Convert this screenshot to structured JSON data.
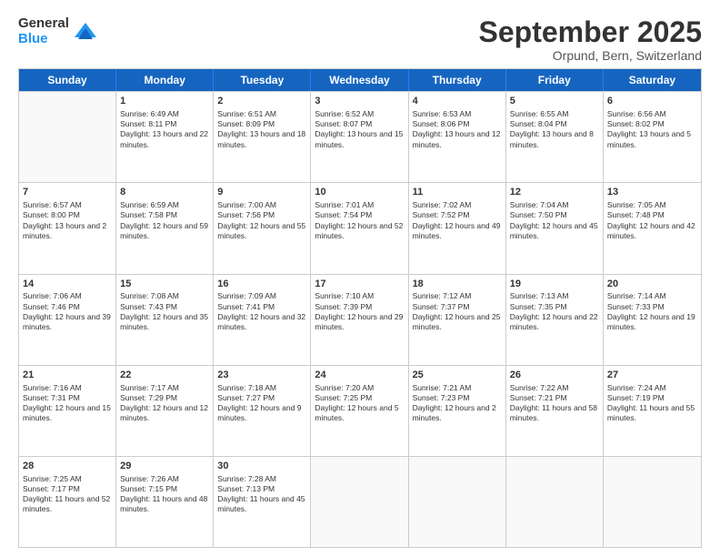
{
  "logo": {
    "general": "General",
    "blue": "Blue"
  },
  "title": {
    "month": "September 2025",
    "location": "Orpund, Bern, Switzerland"
  },
  "header_days": [
    "Sunday",
    "Monday",
    "Tuesday",
    "Wednesday",
    "Thursday",
    "Friday",
    "Saturday"
  ],
  "weeks": [
    [
      {
        "day": "",
        "empty": true
      },
      {
        "day": "1",
        "sunrise": "Sunrise: 6:49 AM",
        "sunset": "Sunset: 8:11 PM",
        "daylight": "Daylight: 13 hours and 22 minutes."
      },
      {
        "day": "2",
        "sunrise": "Sunrise: 6:51 AM",
        "sunset": "Sunset: 8:09 PM",
        "daylight": "Daylight: 13 hours and 18 minutes."
      },
      {
        "day": "3",
        "sunrise": "Sunrise: 6:52 AM",
        "sunset": "Sunset: 8:07 PM",
        "daylight": "Daylight: 13 hours and 15 minutes."
      },
      {
        "day": "4",
        "sunrise": "Sunrise: 6:53 AM",
        "sunset": "Sunset: 8:06 PM",
        "daylight": "Daylight: 13 hours and 12 minutes."
      },
      {
        "day": "5",
        "sunrise": "Sunrise: 6:55 AM",
        "sunset": "Sunset: 8:04 PM",
        "daylight": "Daylight: 13 hours and 8 minutes."
      },
      {
        "day": "6",
        "sunrise": "Sunrise: 6:56 AM",
        "sunset": "Sunset: 8:02 PM",
        "daylight": "Daylight: 13 hours and 5 minutes."
      }
    ],
    [
      {
        "day": "7",
        "sunrise": "Sunrise: 6:57 AM",
        "sunset": "Sunset: 8:00 PM",
        "daylight": "Daylight: 13 hours and 2 minutes."
      },
      {
        "day": "8",
        "sunrise": "Sunrise: 6:59 AM",
        "sunset": "Sunset: 7:58 PM",
        "daylight": "Daylight: 12 hours and 59 minutes."
      },
      {
        "day": "9",
        "sunrise": "Sunrise: 7:00 AM",
        "sunset": "Sunset: 7:56 PM",
        "daylight": "Daylight: 12 hours and 55 minutes."
      },
      {
        "day": "10",
        "sunrise": "Sunrise: 7:01 AM",
        "sunset": "Sunset: 7:54 PM",
        "daylight": "Daylight: 12 hours and 52 minutes."
      },
      {
        "day": "11",
        "sunrise": "Sunrise: 7:02 AM",
        "sunset": "Sunset: 7:52 PM",
        "daylight": "Daylight: 12 hours and 49 minutes."
      },
      {
        "day": "12",
        "sunrise": "Sunrise: 7:04 AM",
        "sunset": "Sunset: 7:50 PM",
        "daylight": "Daylight: 12 hours and 45 minutes."
      },
      {
        "day": "13",
        "sunrise": "Sunrise: 7:05 AM",
        "sunset": "Sunset: 7:48 PM",
        "daylight": "Daylight: 12 hours and 42 minutes."
      }
    ],
    [
      {
        "day": "14",
        "sunrise": "Sunrise: 7:06 AM",
        "sunset": "Sunset: 7:46 PM",
        "daylight": "Daylight: 12 hours and 39 minutes."
      },
      {
        "day": "15",
        "sunrise": "Sunrise: 7:08 AM",
        "sunset": "Sunset: 7:43 PM",
        "daylight": "Daylight: 12 hours and 35 minutes."
      },
      {
        "day": "16",
        "sunrise": "Sunrise: 7:09 AM",
        "sunset": "Sunset: 7:41 PM",
        "daylight": "Daylight: 12 hours and 32 minutes."
      },
      {
        "day": "17",
        "sunrise": "Sunrise: 7:10 AM",
        "sunset": "Sunset: 7:39 PM",
        "daylight": "Daylight: 12 hours and 29 minutes."
      },
      {
        "day": "18",
        "sunrise": "Sunrise: 7:12 AM",
        "sunset": "Sunset: 7:37 PM",
        "daylight": "Daylight: 12 hours and 25 minutes."
      },
      {
        "day": "19",
        "sunrise": "Sunrise: 7:13 AM",
        "sunset": "Sunset: 7:35 PM",
        "daylight": "Daylight: 12 hours and 22 minutes."
      },
      {
        "day": "20",
        "sunrise": "Sunrise: 7:14 AM",
        "sunset": "Sunset: 7:33 PM",
        "daylight": "Daylight: 12 hours and 19 minutes."
      }
    ],
    [
      {
        "day": "21",
        "sunrise": "Sunrise: 7:16 AM",
        "sunset": "Sunset: 7:31 PM",
        "daylight": "Daylight: 12 hours and 15 minutes."
      },
      {
        "day": "22",
        "sunrise": "Sunrise: 7:17 AM",
        "sunset": "Sunset: 7:29 PM",
        "daylight": "Daylight: 12 hours and 12 minutes."
      },
      {
        "day": "23",
        "sunrise": "Sunrise: 7:18 AM",
        "sunset": "Sunset: 7:27 PM",
        "daylight": "Daylight: 12 hours and 9 minutes."
      },
      {
        "day": "24",
        "sunrise": "Sunrise: 7:20 AM",
        "sunset": "Sunset: 7:25 PM",
        "daylight": "Daylight: 12 hours and 5 minutes."
      },
      {
        "day": "25",
        "sunrise": "Sunrise: 7:21 AM",
        "sunset": "Sunset: 7:23 PM",
        "daylight": "Daylight: 12 hours and 2 minutes."
      },
      {
        "day": "26",
        "sunrise": "Sunrise: 7:22 AM",
        "sunset": "Sunset: 7:21 PM",
        "daylight": "Daylight: 11 hours and 58 minutes."
      },
      {
        "day": "27",
        "sunrise": "Sunrise: 7:24 AM",
        "sunset": "Sunset: 7:19 PM",
        "daylight": "Daylight: 11 hours and 55 minutes."
      }
    ],
    [
      {
        "day": "28",
        "sunrise": "Sunrise: 7:25 AM",
        "sunset": "Sunset: 7:17 PM",
        "daylight": "Daylight: 11 hours and 52 minutes."
      },
      {
        "day": "29",
        "sunrise": "Sunrise: 7:26 AM",
        "sunset": "Sunset: 7:15 PM",
        "daylight": "Daylight: 11 hours and 48 minutes."
      },
      {
        "day": "30",
        "sunrise": "Sunrise: 7:28 AM",
        "sunset": "Sunset: 7:13 PM",
        "daylight": "Daylight: 11 hours and 45 minutes."
      },
      {
        "day": "",
        "empty": true
      },
      {
        "day": "",
        "empty": true
      },
      {
        "day": "",
        "empty": true
      },
      {
        "day": "",
        "empty": true
      }
    ]
  ]
}
